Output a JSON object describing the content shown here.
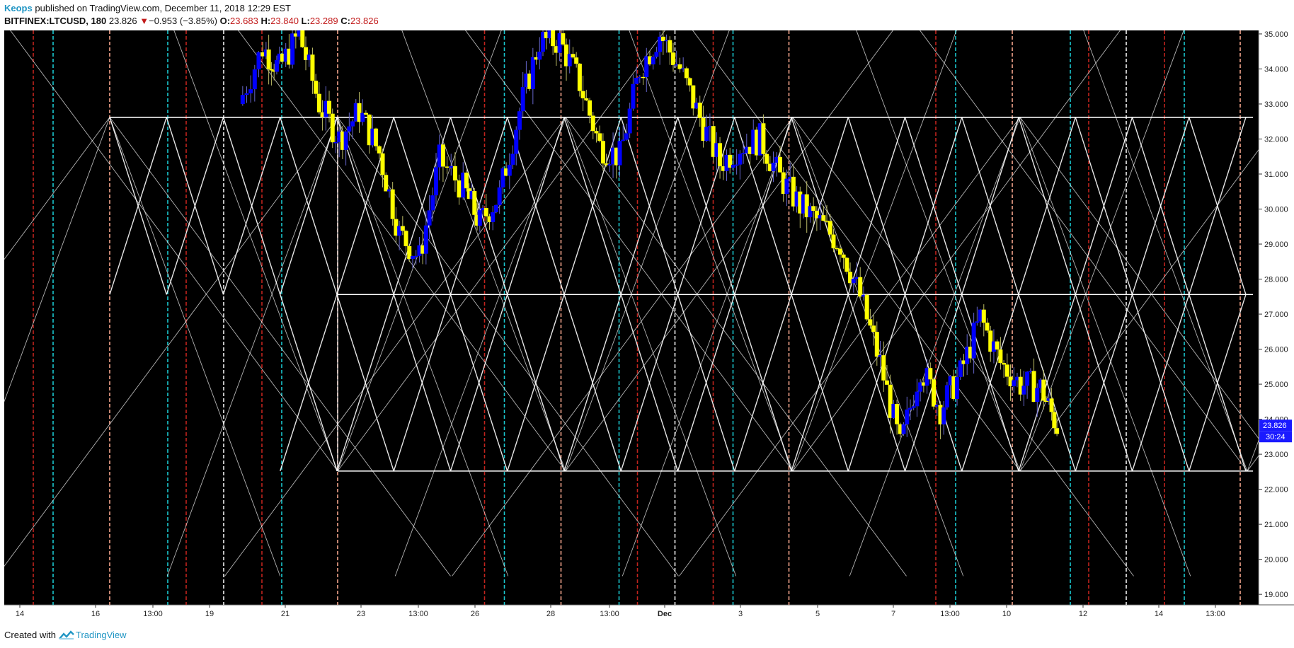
{
  "header": {
    "author": "Keops",
    "published_text": "published on TradingView.com, December 11, 2018 12:29 EST",
    "symbol": "BITFINEX:LTCUSD, 180",
    "last": "23.826",
    "change_arrow": "▼",
    "change": "−0.953 (−3.85%)",
    "open_label": "O:",
    "open": "23.683",
    "high_label": "H:",
    "high": "23.840",
    "low_label": "L:",
    "low": "23.289",
    "close_label": "C:",
    "close": "23.826"
  },
  "footer": {
    "created_with": "Created with",
    "brand": "TradingView"
  },
  "colors": {
    "background": "#000000",
    "bull": "#ffff00",
    "bear": "#0000ff",
    "grid_lines": "#ffffff",
    "cycle_red": "#c0231d",
    "cycle_cyan": "#19c8d0",
    "cycle_salmon": "#f4a48c",
    "cycle_white": "#f0f0f0",
    "price_tag": "#1a1aff"
  },
  "chart_data": {
    "type": "candlestick",
    "ylim": [
      18.7,
      35.1
    ],
    "yticks": [
      "35.000",
      "34.000",
      "33.000",
      "32.000",
      "31.000",
      "30.000",
      "29.000",
      "28.000",
      "27.000",
      "26.000",
      "25.000",
      "24.000",
      "23.000",
      "22.000",
      "21.000",
      "20.000",
      "19.000"
    ],
    "xticks": [
      "14",
      "16",
      "13:00",
      "19",
      "21",
      "23",
      "13:00",
      "26",
      "28",
      "13:00",
      "Dec",
      "3",
      "5",
      "7",
      "13:00",
      "10",
      "12",
      "14",
      "13:00"
    ],
    "price_tag": {
      "value": 23.826,
      "text": "23.826",
      "countdown": "30:24"
    },
    "close_path": [
      [
        0.0,
        33.0
      ],
      [
        0.6,
        34.6
      ],
      [
        1.0,
        34.0
      ],
      [
        1.5,
        35.0
      ],
      [
        2.0,
        33.0
      ],
      [
        2.5,
        32.0
      ],
      [
        3.0,
        32.8
      ],
      [
        3.5,
        31.6
      ],
      [
        4.0,
        29.3
      ],
      [
        4.5,
        28.6
      ],
      [
        5.0,
        31.4
      ],
      [
        5.6,
        30.6
      ],
      [
        6.0,
        29.6
      ],
      [
        6.5,
        30.4
      ],
      [
        7.0,
        32.8
      ],
      [
        7.5,
        34.8
      ],
      [
        8.0,
        34.8
      ],
      [
        8.5,
        33.6
      ],
      [
        9.0,
        31.8
      ],
      [
        9.5,
        31.5
      ],
      [
        10.0,
        34.0
      ],
      [
        10.5,
        35.0
      ],
      [
        11.0,
        34.0
      ],
      [
        11.5,
        32.6
      ],
      [
        12.0,
        31.3
      ],
      [
        12.5,
        31.8
      ],
      [
        13.0,
        32.0
      ],
      [
        13.5,
        30.9
      ],
      [
        14.0,
        30.1
      ],
      [
        14.5,
        29.6
      ],
      [
        15.0,
        29.0
      ],
      [
        15.5,
        27.5
      ],
      [
        16.0,
        25.6
      ],
      [
        16.5,
        23.2
      ],
      [
        17.0,
        25.5
      ],
      [
        17.5,
        24.3
      ],
      [
        18.0,
        25.3
      ],
      [
        18.5,
        26.9
      ],
      [
        19.0,
        25.6
      ],
      [
        19.5,
        25.0
      ],
      [
        20.0,
        24.9
      ],
      [
        20.4,
        23.8
      ]
    ]
  }
}
